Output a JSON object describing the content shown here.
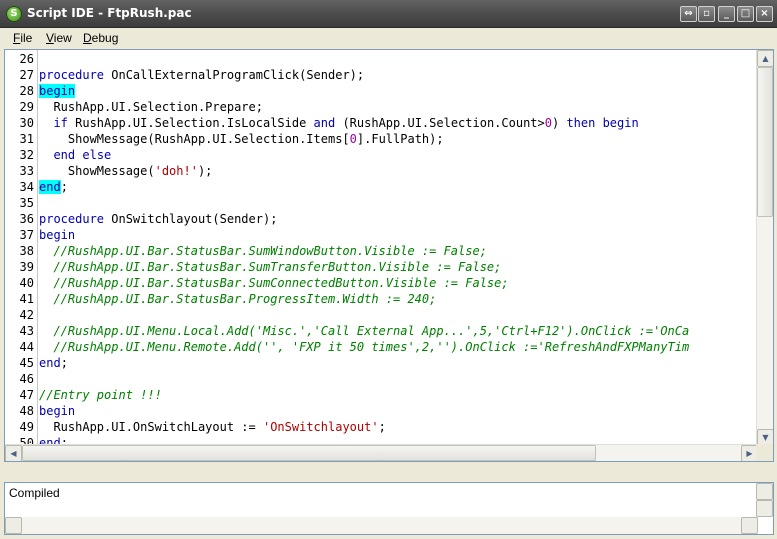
{
  "window": {
    "title": "Script IDE - FtpRush.pac",
    "controls": [
      "restore",
      "pin",
      "minimize",
      "maximize",
      "close"
    ]
  },
  "menu": [
    {
      "label": "File",
      "accel": "F",
      "rest": "ile"
    },
    {
      "label": "View",
      "accel": "V",
      "rest": "iew"
    },
    {
      "label": "Debug",
      "accel": "D",
      "rest": "ebug"
    }
  ],
  "editor": {
    "lines": [
      {
        "n": "26",
        "parts": []
      },
      {
        "n": "27",
        "parts": [
          {
            "t": "procedure",
            "c": "kw"
          },
          {
            "t": " OnCallExternalProgramClick(Sender);",
            "c": ""
          }
        ]
      },
      {
        "n": "28",
        "parts": [
          {
            "t": "begin",
            "c": "kw hl"
          }
        ]
      },
      {
        "n": "29",
        "parts": [
          {
            "t": "  RushApp.UI.Selection.Prepare;",
            "c": ""
          }
        ]
      },
      {
        "n": "30",
        "parts": [
          {
            "t": "  ",
            "c": ""
          },
          {
            "t": "if",
            "c": "kw"
          },
          {
            "t": " RushApp.UI.Selection.IsLocalSide ",
            "c": ""
          },
          {
            "t": "and",
            "c": "kw"
          },
          {
            "t": " (RushApp.UI.Selection.Count>",
            "c": ""
          },
          {
            "t": "0",
            "c": "nm"
          },
          {
            "t": ") ",
            "c": ""
          },
          {
            "t": "then",
            "c": "kw"
          },
          {
            "t": " ",
            "c": ""
          },
          {
            "t": "begin",
            "c": "kw"
          }
        ]
      },
      {
        "n": "31",
        "parts": [
          {
            "t": "    ShowMessage(RushApp.UI.Selection.Items[",
            "c": ""
          },
          {
            "t": "0",
            "c": "nm"
          },
          {
            "t": "].FullPath);",
            "c": ""
          }
        ]
      },
      {
        "n": "32",
        "parts": [
          {
            "t": "  ",
            "c": ""
          },
          {
            "t": "end",
            "c": "kw"
          },
          {
            "t": " ",
            "c": ""
          },
          {
            "t": "else",
            "c": "kw"
          }
        ]
      },
      {
        "n": "33",
        "parts": [
          {
            "t": "    ShowMessage(",
            "c": ""
          },
          {
            "t": "'doh!'",
            "c": "st"
          },
          {
            "t": ");",
            "c": ""
          }
        ]
      },
      {
        "n": "34",
        "parts": [
          {
            "t": "end",
            "c": "kw hl"
          },
          {
            "t": ";",
            "c": ""
          }
        ]
      },
      {
        "n": "35",
        "parts": []
      },
      {
        "n": "36",
        "parts": [
          {
            "t": "procedure",
            "c": "kw"
          },
          {
            "t": " OnSwitchlayout(Sender);",
            "c": ""
          }
        ]
      },
      {
        "n": "37",
        "parts": [
          {
            "t": "begin",
            "c": "kw"
          }
        ]
      },
      {
        "n": "38",
        "parts": [
          {
            "t": "  //RushApp.UI.Bar.StatusBar.SumWindowButton.Visible := False;",
            "c": "cm"
          }
        ]
      },
      {
        "n": "39",
        "parts": [
          {
            "t": "  //RushApp.UI.Bar.StatusBar.SumTransferButton.Visible := False;",
            "c": "cm"
          }
        ]
      },
      {
        "n": "40",
        "parts": [
          {
            "t": "  //RushApp.UI.Bar.StatusBar.SumConnectedButton.Visible := False;",
            "c": "cm"
          }
        ]
      },
      {
        "n": "41",
        "parts": [
          {
            "t": "  //RushApp.UI.Bar.StatusBar.ProgressItem.Width := 240;",
            "c": "cm"
          }
        ]
      },
      {
        "n": "42",
        "parts": []
      },
      {
        "n": "43",
        "parts": [
          {
            "t": "  //RushApp.UI.Menu.Local.Add('Misc.','Call External App...',5,'Ctrl+F12').OnClick :='OnCa",
            "c": "cm"
          }
        ]
      },
      {
        "n": "44",
        "parts": [
          {
            "t": "  //RushApp.UI.Menu.Remote.Add('', 'FXP it 50 times',2,'').OnClick :='RefreshAndFXPManyTim",
            "c": "cm"
          }
        ]
      },
      {
        "n": "45",
        "parts": [
          {
            "t": "end",
            "c": "kw"
          },
          {
            "t": ";",
            "c": ""
          }
        ]
      },
      {
        "n": "46",
        "parts": []
      },
      {
        "n": "47",
        "parts": [
          {
            "t": "//Entry point !!!",
            "c": "cm"
          }
        ]
      },
      {
        "n": "48",
        "parts": [
          {
            "t": "begin",
            "c": "kw"
          }
        ]
      },
      {
        "n": "49",
        "parts": [
          {
            "t": "  RushApp.UI.OnSwitchLayout := ",
            "c": ""
          },
          {
            "t": "'OnSwitchlayout'",
            "c": "st"
          },
          {
            "t": ";",
            "c": ""
          }
        ]
      },
      {
        "n": "50",
        "parts": [
          {
            "t": "end",
            "c": "kw"
          },
          {
            "t": ";",
            "c": ""
          }
        ]
      }
    ]
  },
  "output": {
    "text": "Compiled"
  },
  "icons": {
    "app": "script-icon",
    "scroll_up": "arrow-up-icon",
    "scroll_down": "arrow-down-icon",
    "scroll_left": "arrow-left-icon",
    "scroll_right": "arrow-right-icon"
  },
  "colors": {
    "keyword": "#0000b0",
    "comment": "#008000",
    "string": "#b00000",
    "number": "#a000a0",
    "highlight": "#00ffff"
  }
}
